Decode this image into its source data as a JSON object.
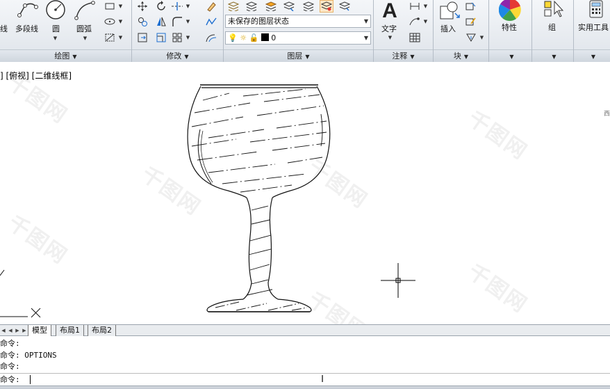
{
  "ribbon": {
    "draw_panel": {
      "title": "绘图",
      "items": {
        "line": "线",
        "polyline": "多段线",
        "circle": "圆",
        "arc": "圆弧"
      }
    },
    "modify_panel": {
      "title": "修改"
    },
    "layer_panel": {
      "title": "图层",
      "layer_state": "未保存的图层状态",
      "current_layer": "0"
    },
    "annotation_panel": {
      "title": "注释",
      "text": "文字"
    },
    "block_panel": {
      "title": "块",
      "insert": "插入"
    },
    "properties": {
      "label": "特性"
    },
    "group": {
      "label": "组"
    },
    "utilities": {
      "label": "实用工具"
    }
  },
  "viewport": {
    "label": "[-][俯视][二维线框]",
    "label_visible": "] [俯视] [二维线框]",
    "right_mark": "西",
    "watermark": "千图网"
  },
  "layout_tabs": [
    {
      "label": "模型",
      "active": true
    },
    {
      "label": "布局1",
      "active": false
    },
    {
      "label": "布局2",
      "active": false
    }
  ],
  "command": {
    "history": [
      "命令:",
      "命令: OPTIONS",
      "命令:"
    ],
    "prompt": "命令:"
  },
  "colors": {
    "ribbon_bg": "#dfe4ea",
    "layer_color": "#000000",
    "properties_wheel": [
      "#e53935",
      "#fdd835",
      "#43a047",
      "#1e88e5",
      "#8e24aa"
    ]
  }
}
